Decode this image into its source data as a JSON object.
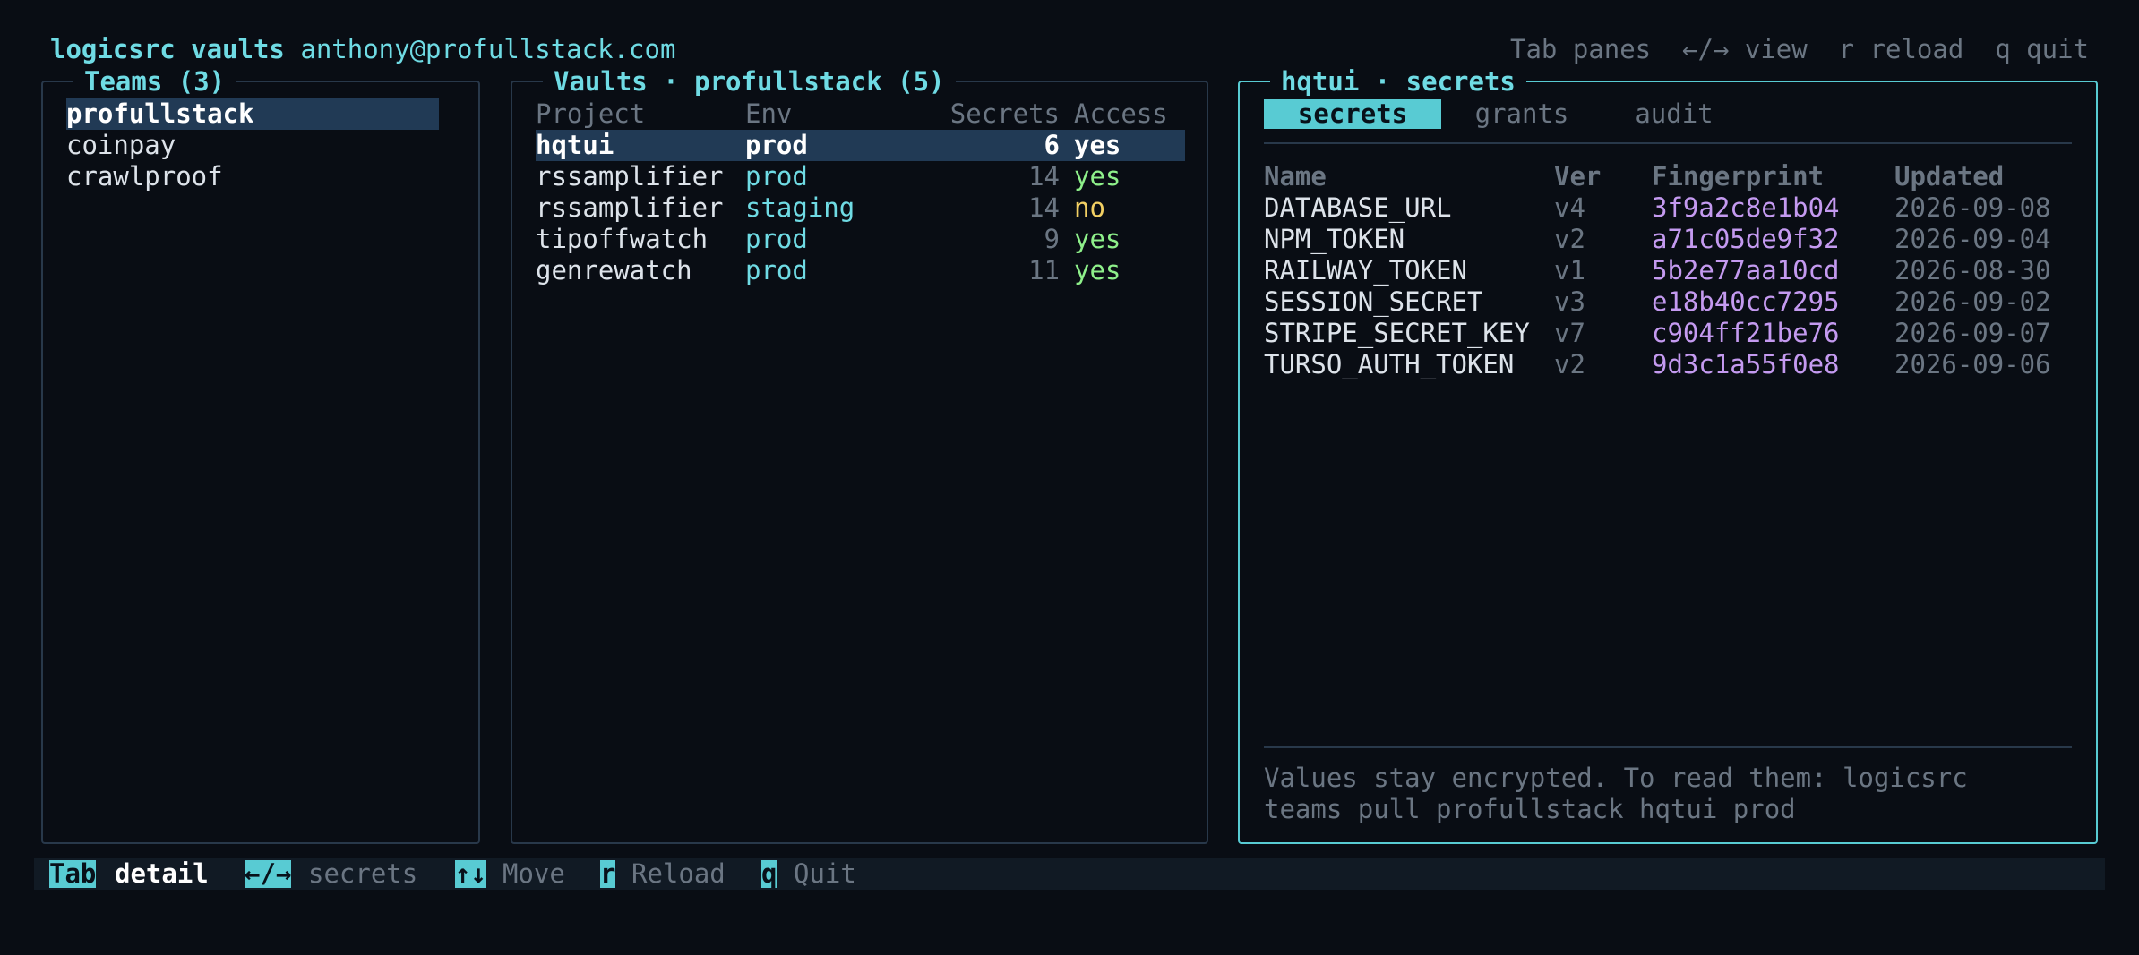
{
  "header": {
    "app": "logicsrc vaults",
    "user": "anthony@profullstack.com",
    "hints": "Tab panes  ←/→ view  r reload  q quit"
  },
  "teams": {
    "title": "Teams (3)",
    "items": [
      "profullstack",
      "coinpay",
      "crawlproof"
    ],
    "selected_index": 0
  },
  "vaults": {
    "title": "Vaults · profullstack (5)",
    "columns": {
      "project": "Project",
      "env": "Env",
      "secrets": "Secrets",
      "access": "Access"
    },
    "rows": [
      {
        "project": "hqtui",
        "env": "prod",
        "secrets": "6",
        "access": "yes"
      },
      {
        "project": "rssamplifier",
        "env": "prod",
        "secrets": "14",
        "access": "yes"
      },
      {
        "project": "rssamplifier",
        "env": "staging",
        "secrets": "14",
        "access": "no"
      },
      {
        "project": "tipoffwatch",
        "env": "prod",
        "secrets": "9",
        "access": "yes"
      },
      {
        "project": "genrewatch",
        "env": "prod",
        "secrets": "11",
        "access": "yes"
      }
    ],
    "selected_index": 0
  },
  "detail": {
    "title": "hqtui · secrets",
    "tabs": [
      "secrets",
      "grants",
      "audit"
    ],
    "active_tab": "secrets",
    "columns": {
      "name": "Name",
      "ver": "Ver",
      "fingerprint": "Fingerprint",
      "updated": "Updated"
    },
    "rows": [
      {
        "name": "DATABASE_URL",
        "ver": "v4",
        "fingerprint": "3f9a2c8e1b04",
        "updated": "2026-09-08"
      },
      {
        "name": "NPM_TOKEN",
        "ver": "v2",
        "fingerprint": "a71c05de9f32",
        "updated": "2026-09-04"
      },
      {
        "name": "RAILWAY_TOKEN",
        "ver": "v1",
        "fingerprint": "5b2e77aa10cd",
        "updated": "2026-08-30"
      },
      {
        "name": "SESSION_SECRET",
        "ver": "v3",
        "fingerprint": "e18b40cc7295",
        "updated": "2026-09-02"
      },
      {
        "name": "STRIPE_SECRET_KEY",
        "ver": "v7",
        "fingerprint": "c904ff21be76",
        "updated": "2026-09-07"
      },
      {
        "name": "TURSO_AUTH_TOKEN",
        "ver": "v2",
        "fingerprint": "9d3c1a55f0e8",
        "updated": "2026-09-06"
      }
    ],
    "note_line1": "Values stay encrypted. To read them: logicsrc",
    "note_line2": "teams pull profullstack hqtui prod"
  },
  "keybar": [
    {
      "key": "Tab",
      "label": "detail"
    },
    {
      "key": "←/→",
      "label": "secrets"
    },
    {
      "key": "↑↓",
      "label": "Move"
    },
    {
      "key": "r",
      "label": "Reload"
    },
    {
      "key": "q",
      "label": "Quit"
    }
  ],
  "colors": {
    "accent": "#58cbd3",
    "selection": "#213a55",
    "yes": "#8ef08a",
    "no": "#f2cf63",
    "fingerprint": "#c49af0"
  }
}
